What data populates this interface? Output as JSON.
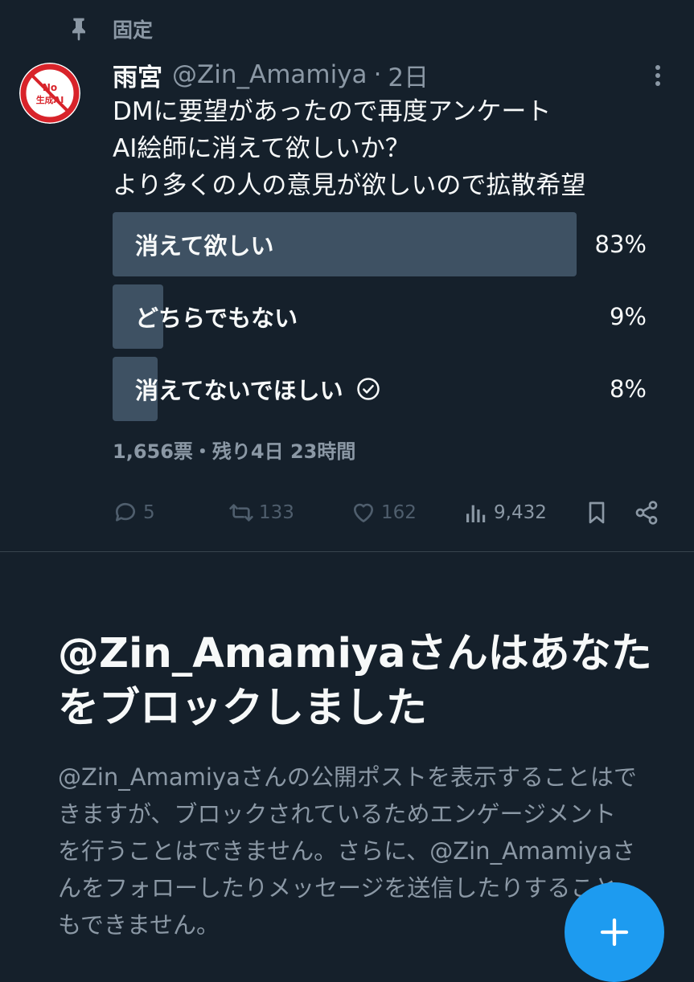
{
  "pinned": {
    "label": "固定"
  },
  "avatar": {
    "line1": "No",
    "line2": "生成AI",
    "ring_text": "NO MORE 無断学習"
  },
  "tweet": {
    "display_name": "雨宮",
    "handle": "@Zin_Amamiya",
    "separator": "·",
    "time": "2日",
    "lines": [
      "DMに要望があったので再度アンケート",
      "AI絵師に消えて欲しいか？",
      "より多くの人の意見が欲しいので拡散希望"
    ]
  },
  "poll": {
    "options": [
      {
        "label": "消えて欲しい",
        "percent_text": "83%",
        "percent": 83,
        "selected": false
      },
      {
        "label": "どちらでもない",
        "percent_text": "9%",
        "percent": 9,
        "selected": false
      },
      {
        "label": "消えてないでほしい",
        "percent_text": "8%",
        "percent": 8,
        "selected": true
      }
    ],
    "meta": "1,656票・残り4日 23時間"
  },
  "actions": {
    "replies": "5",
    "retweets": "133",
    "likes": "162",
    "views": "9,432"
  },
  "block_notice": {
    "title": "@Zin_Amamiyaさんはあなたをブロックしました",
    "description": "@Zin_Amamiyaさんの公開ポストを表示することはできますが、ブロックされているためエンゲージメントを行うことはできません。さらに、@Zin_Amamiyaさんをフォローしたりメッセージを送信したりすることもできません。"
  },
  "colors": {
    "background": "#15202b",
    "poll_fill": "#3e5163",
    "accent": "#1d9bf0",
    "muted_text": "#8b98a5"
  },
  "icons": {
    "pin": "pin-icon",
    "more": "more-icon",
    "check": "check-circle-icon",
    "reply": "reply-icon",
    "retweet": "retweet-icon",
    "like": "heart-icon",
    "views": "views-icon",
    "bookmark": "bookmark-icon",
    "share": "share-icon",
    "compose": "plus-icon"
  }
}
